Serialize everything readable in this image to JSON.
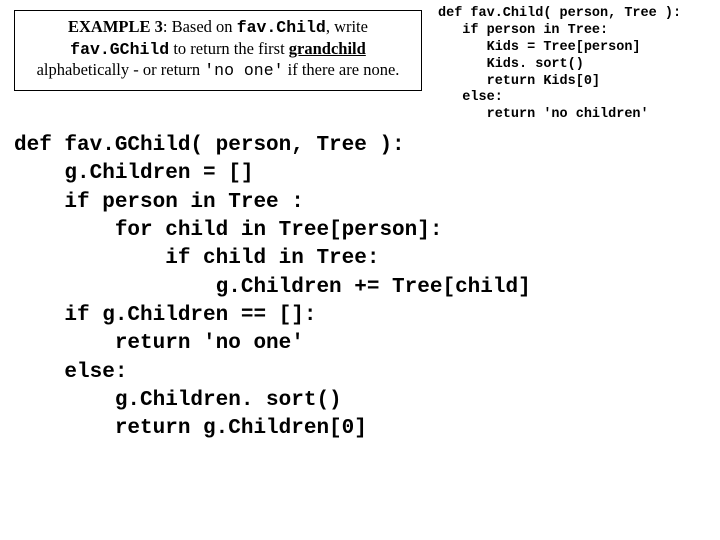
{
  "example": {
    "label": "EXAMPLE 3",
    "pre1": ": Based on ",
    "fn1": "fav.Child",
    "mid1": ", write ",
    "fn2": "fav.GChild",
    "mid2": " to return the first ",
    "grand": "grandchild",
    "mid3": " alphabetically - or return ",
    "lit": "'no one'",
    "tail": " if there are none."
  },
  "ref": {
    "l1": "def fav.Child( person, Tree ):",
    "l2": "   if person in Tree:",
    "l3": "      Kids = Tree[person]",
    "l4": "      Kids. sort()",
    "l5": "      return Kids[0]",
    "l6": "   else:",
    "l7": "      return 'no children'"
  },
  "main": {
    "l1": "def fav.GChild( person, Tree ):",
    "l2": "    g.Children = []",
    "l3": "    if person in Tree :",
    "l4": "        for child in Tree[person]:",
    "l5": "            if child in Tree:",
    "l6": "                g.Children += Tree[child]",
    "l7": "    if g.Children == []:",
    "l8": "        return 'no one'",
    "l9": "    else:",
    "l10": "        g.Children. sort()",
    "l11": "        return g.Children[0]"
  }
}
